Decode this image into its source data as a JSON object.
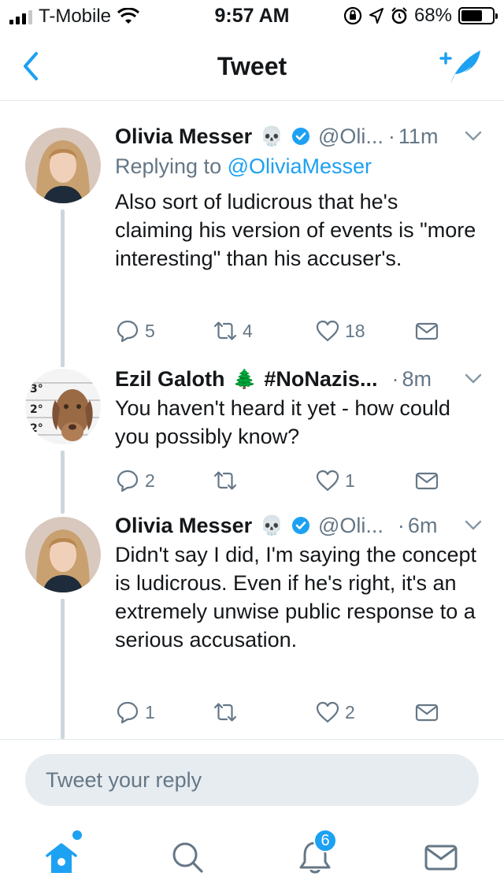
{
  "status_bar": {
    "carrier": "T-Mobile",
    "time": "9:57 AM",
    "battery_percent": "68%",
    "battery_level": 0.68,
    "icons": [
      "signal-icon",
      "wifi-icon",
      "orientation-lock-icon",
      "location-icon",
      "alarm-icon",
      "battery-icon"
    ]
  },
  "nav": {
    "title": "Tweet",
    "back_icon": "chevron-left-icon",
    "compose_icon": "compose-tweet-icon"
  },
  "tweets": [
    {
      "name": "Olivia Messer",
      "emoji": "💀",
      "verified": true,
      "handle": "@Oli...",
      "time": "11m",
      "reply_prefix": "Replying to",
      "reply_mention": "@OliviaMesser",
      "text": "Also sort of ludicrous that he's claiming his version of events is \"more interesting\" than his accuser's.",
      "replies": "5",
      "retweets": "4",
      "likes": "18"
    },
    {
      "name": "Ezil Galoth",
      "emoji": "🌲",
      "hashtag": "#NoNazis...",
      "time": "8m",
      "text": "You haven't heard it yet - how could you possibly know?",
      "replies": "2",
      "retweets": "",
      "likes": "1"
    },
    {
      "name": "Olivia Messer",
      "emoji": "💀",
      "verified": true,
      "handle": "@Oli...",
      "time": "6m",
      "text": "Didn't say I did, I'm saying the concept is ludicrous. Even if he's right, it's an extremely unwise public response to a serious accusation.",
      "replies": "1",
      "retweets": "",
      "likes": "2"
    }
  ],
  "reply_box": {
    "placeholder": "Tweet your reply"
  },
  "tabbar": {
    "notifications_badge": "6",
    "icons": [
      "home-icon",
      "search-icon",
      "notifications-icon",
      "messages-icon"
    ]
  },
  "colors": {
    "accent": "#1da1f2",
    "text": "#14171a",
    "secondary": "#657786",
    "divider": "#e1e8ed"
  }
}
